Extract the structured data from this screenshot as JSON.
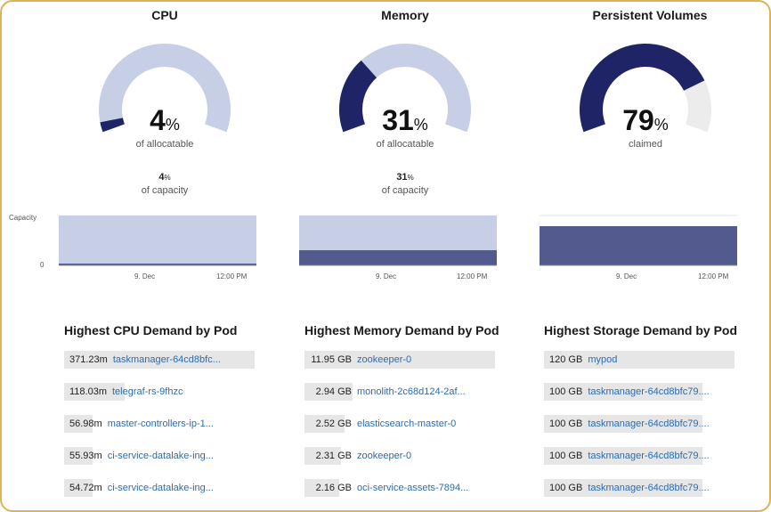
{
  "colors": {
    "gauge_track": "#c6cfe6",
    "gauge_fill_dark": "#1e2466",
    "pv_track": "#ececec",
    "chart_light": "#c6cfe6",
    "chart_dark": "#525a8e",
    "link": "#2b6cb0",
    "frame": "#d9b45a"
  },
  "gauges": [
    {
      "title": "CPU",
      "value": 4,
      "value_text": "4",
      "unit": "%",
      "caption": "of allocatable",
      "capacity_value": "4",
      "capacity_unit": "%",
      "capacity_label": "of capacity"
    },
    {
      "title": "Memory",
      "value": 31,
      "value_text": "31",
      "unit": "%",
      "caption": "of allocatable",
      "capacity_value": "31",
      "capacity_unit": "%",
      "capacity_label": "of capacity"
    },
    {
      "title": "Persistent Volumes",
      "value": 79,
      "value_text": "79",
      "unit": "%",
      "caption": "claimed"
    }
  ],
  "charts": {
    "y_labels": [
      "Capacity",
      "0"
    ],
    "x_labels": [
      "9. Dec",
      "12:00 PM"
    ],
    "cpu_usage_fraction": 0.04,
    "memory_usage_fraction": 0.31,
    "pv_usage_fraction": 0.79
  },
  "sections": [
    {
      "title": "Highest CPU Demand by Pod",
      "rows": [
        {
          "value": "371.23m",
          "name": "taskmanager-64cd8bfc...",
          "fraction": 1.0
        },
        {
          "value": "118.03m",
          "name": "telegraf-rs-9fhzc",
          "fraction": 0.32
        },
        {
          "value": "56.98m",
          "name": "master-controllers-ip-1...",
          "fraction": 0.15
        },
        {
          "value": "55.93m",
          "name": "ci-service-datalake-ing...",
          "fraction": 0.15
        },
        {
          "value": "54.72m",
          "name": "ci-service-datalake-ing...",
          "fraction": 0.15
        }
      ]
    },
    {
      "title": "Highest Memory Demand by Pod",
      "rows": [
        {
          "value": "11.95 GB",
          "name": "zookeeper-0",
          "fraction": 1.0
        },
        {
          "value": "2.94 GB",
          "name": "monolith-2c68d124-2af...",
          "fraction": 0.25
        },
        {
          "value": "2.52 GB",
          "name": "elasticsearch-master-0",
          "fraction": 0.21
        },
        {
          "value": "2.31 GB",
          "name": "zookeeper-0",
          "fraction": 0.19
        },
        {
          "value": "2.16 GB",
          "name": "oci-service-assets-7894...",
          "fraction": 0.18
        }
      ]
    },
    {
      "title": "Highest Storage Demand by Pod",
      "rows": [
        {
          "value": "120 GB",
          "name": "mypod",
          "fraction": 1.0
        },
        {
          "value": "100 GB",
          "name": "taskmanager-64cd8bfc79....",
          "fraction": 0.83
        },
        {
          "value": "100 GB",
          "name": "taskmanager-64cd8bfc79....",
          "fraction": 0.83
        },
        {
          "value": "100 GB",
          "name": "taskmanager-64cd8bfc79....",
          "fraction": 0.83
        },
        {
          "value": "100 GB",
          "name": "taskmanager-64cd8bfc79....",
          "fraction": 0.83
        }
      ]
    }
  ]
}
